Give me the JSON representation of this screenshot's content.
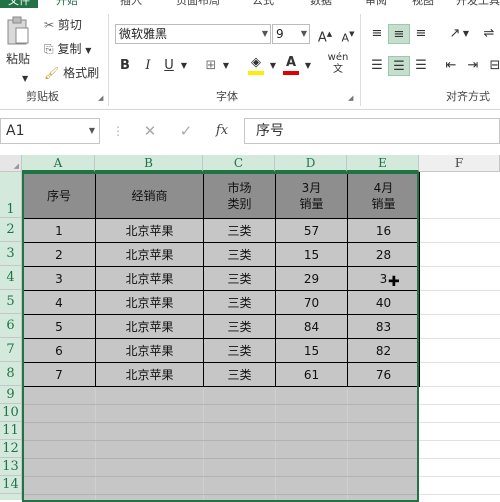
{
  "ribbon_tabs": [
    "文件",
    "开始",
    "插入",
    "页面布局",
    "公式",
    "数据",
    "审阅",
    "视图",
    "开发工具"
  ],
  "clipboard": {
    "paste": "粘贴",
    "cut": "剪切",
    "copy": "复制",
    "format_painter": "格式刷",
    "group_label": "剪贴板"
  },
  "font": {
    "name": "微软雅黑",
    "size": "9",
    "bold": "B",
    "italic": "I",
    "underline": "U",
    "group_label": "字体",
    "wen": "wén",
    "wen_char": "文"
  },
  "alignment": {
    "group_label": "对齐方式"
  },
  "formula_bar": {
    "name_box": "A1",
    "fx": "fx",
    "value": "序号"
  },
  "columns": [
    "A",
    "B",
    "C",
    "D",
    "E",
    "F"
  ],
  "rows": [
    "1",
    "2",
    "3",
    "4",
    "5",
    "6",
    "7",
    "8",
    "9",
    "10",
    "11",
    "12",
    "13",
    "14"
  ],
  "table": {
    "headers": [
      {
        "line1": "序号",
        "line2": ""
      },
      {
        "line1": "经销商",
        "line2": ""
      },
      {
        "line1": "市场",
        "line2": "类别"
      },
      {
        "line1": "3月",
        "line2": "销量"
      },
      {
        "line1": "4月",
        "line2": "销量"
      }
    ],
    "rows": [
      [
        "1",
        "北京苹果",
        "三类",
        "57",
        "16"
      ],
      [
        "2",
        "北京苹果",
        "三类",
        "15",
        "28"
      ],
      [
        "3",
        "北京苹果",
        "三类",
        "29",
        "3"
      ],
      [
        "4",
        "北京苹果",
        "三类",
        "70",
        "40"
      ],
      [
        "5",
        "北京苹果",
        "三类",
        "84",
        "83"
      ],
      [
        "6",
        "北京苹果",
        "三类",
        "15",
        "82"
      ],
      [
        "7",
        "北京苹果",
        "三类",
        "61",
        "76"
      ]
    ]
  },
  "colors": {
    "accent": "#217346",
    "selection": "#c6c6c6",
    "header_fill": "#8e8e8e"
  }
}
